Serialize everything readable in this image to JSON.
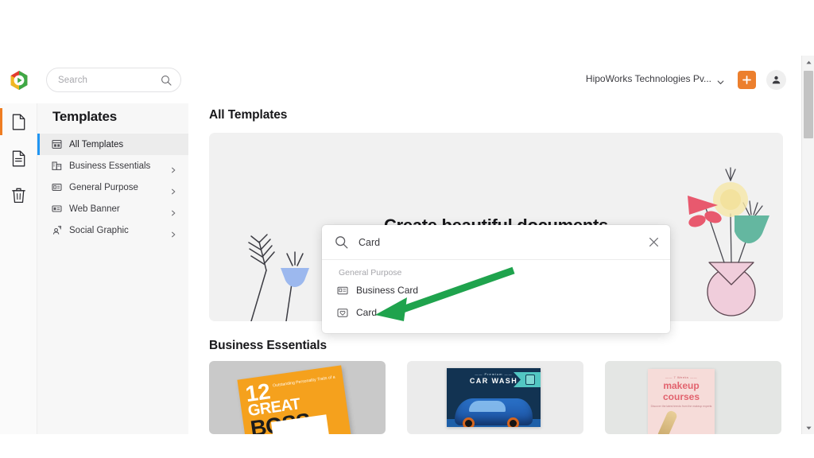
{
  "window": {
    "background_color": "#ffffff"
  },
  "topbar": {
    "logo_name": "app-logo",
    "search": {
      "placeholder": "Search",
      "value": "",
      "icon": "search-icon"
    },
    "org": {
      "name": "HipoWorks Technologies Pv...",
      "chevron_icon": "chevron-down-icon"
    },
    "create_button": {
      "label": "+",
      "icon": "plus-icon",
      "color": "#ec7f2d"
    },
    "account_button": {
      "icon": "user-avatar-icon"
    }
  },
  "rail": {
    "items": [
      {
        "name": "documents",
        "icon": "document-icon",
        "active": true
      },
      {
        "name": "drafts",
        "icon": "document-lines-icon",
        "active": false
      },
      {
        "name": "trash",
        "icon": "trash-icon",
        "active": false
      }
    ]
  },
  "sidebar": {
    "title": "Templates",
    "items": [
      {
        "label": "All Templates",
        "icon": "grid-template-icon",
        "selected": true,
        "has_arrow": false
      },
      {
        "label": "Business Essentials",
        "icon": "building-icon",
        "selected": false,
        "has_arrow": true
      },
      {
        "label": "General Purpose",
        "icon": "list-card-icon",
        "selected": false,
        "has_arrow": true
      },
      {
        "label": "Web Banner",
        "icon": "banner-icon",
        "selected": false,
        "has_arrow": true
      },
      {
        "label": "Social Graphic",
        "icon": "share-person-icon",
        "selected": false,
        "has_arrow": true
      }
    ]
  },
  "main": {
    "all_templates_title": "All Templates",
    "hero": {
      "title": "Create beautiful documents",
      "background_color": "#f1f1f1",
      "decor_left": "wheat-and-blue-tulip-illustration",
      "decor_right": "flower-vase-illustration"
    },
    "business_essentials_title": "Business Essentials",
    "thumbnails": [
      {
        "name": "great-boss-book",
        "number": "12",
        "subtitle": "Outstanding Personality Traits of a",
        "line1": "GREAT",
        "line2": "BOSS"
      },
      {
        "name": "car-wash-flyer",
        "eyebrow": "—— Premium ——",
        "title": "CAR WASH"
      },
      {
        "name": "makeup-courses-flyer",
        "eyebrow": "—— 7 Weeks ——",
        "title_line1": "makeup",
        "title_line2": "courses",
        "body": "Discover the latest trends from the makeup experts"
      }
    ]
  },
  "search_overlay": {
    "query": "Card",
    "search_icon": "search-icon",
    "close_icon": "close-icon",
    "group_label": "General Purpose",
    "results": [
      {
        "label": "Business Card",
        "icon": "id-card-icon"
      },
      {
        "label": "Card",
        "icon": "card-heart-icon"
      }
    ]
  },
  "annotation": {
    "arrow": {
      "name": "green-arrow-annotation",
      "color": "#1fa34d",
      "points_to": "Card"
    }
  },
  "scrollbar": {
    "up_icon": "caret-up-icon",
    "down_icon": "caret-down-icon",
    "thumb": "scroll-thumb"
  }
}
